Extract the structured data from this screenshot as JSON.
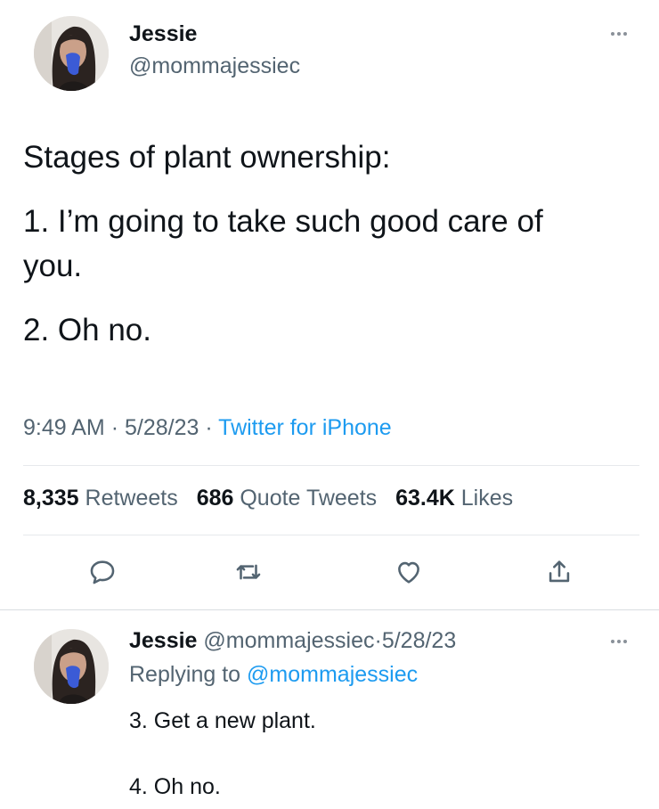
{
  "main_tweet": {
    "author": {
      "name": "Jessie",
      "handle": "@mommajessiec"
    },
    "text_lines": [
      "Stages of plant ownership:",
      "1. I’m going to take such good care of",
      "you.",
      "2. Oh no."
    ],
    "time": "9:49 AM",
    "date": "5/28/23",
    "source": "Twitter for iPhone",
    "separator": "·",
    "stats": {
      "retweets_count": "8,335",
      "retweets_label": "Retweets",
      "quotes_count": "686",
      "quotes_label": "Quote Tweets",
      "likes_count": "63.4K",
      "likes_label": "Likes"
    },
    "actions": [
      "reply-icon",
      "retweet-icon",
      "like-icon",
      "share-icon"
    ]
  },
  "reply_tweet": {
    "author": {
      "name": "Jessie",
      "handle": "@mommajessiec"
    },
    "date": "5/28/23",
    "replying_prefix": "Replying to",
    "replying_to": "@mommajessiec",
    "text_lines": [
      "3. Get a new plant.",
      "4. Oh no."
    ]
  },
  "colors": {
    "link": "#1d9bf0",
    "secondary": "#536471",
    "primary": "#0f1419"
  }
}
